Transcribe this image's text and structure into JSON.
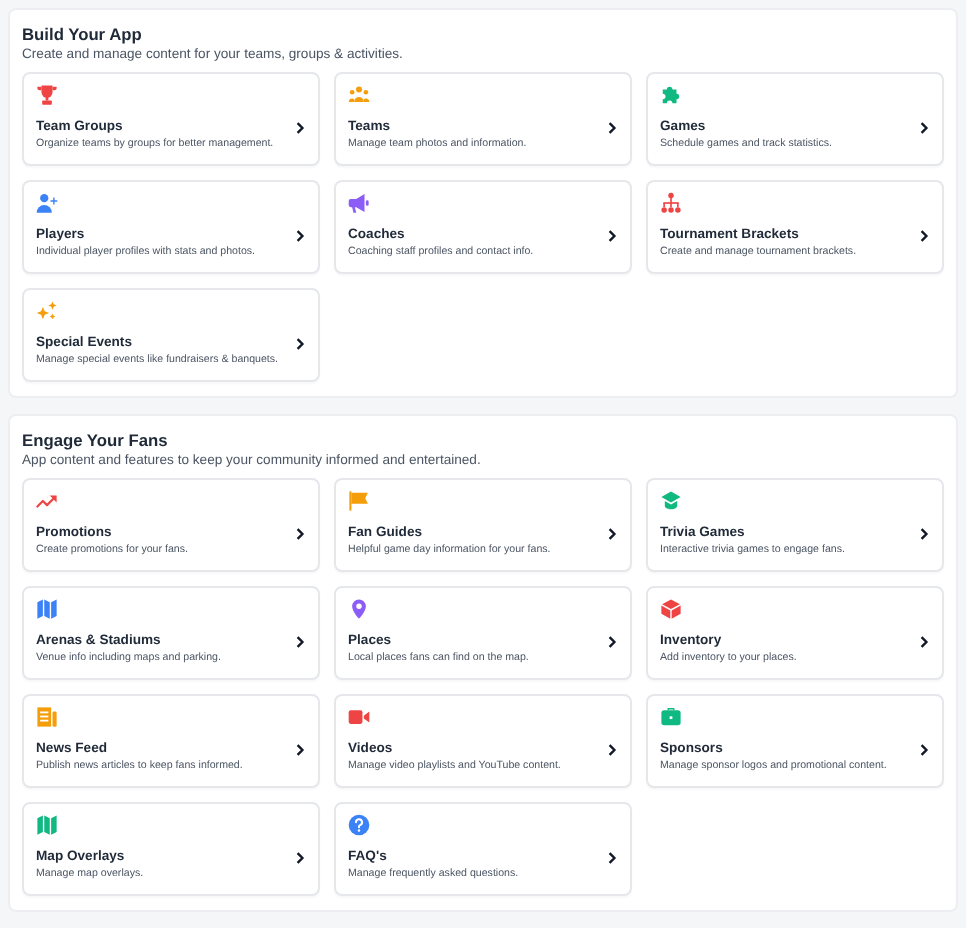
{
  "sections": [
    {
      "title": "Build Your App",
      "subtitle": "Create and manage content for your teams, groups & activities.",
      "items": [
        {
          "kind": "trophy",
          "color": "#ef4444",
          "title": "Team Groups",
          "description": "Organize teams by groups for better management."
        },
        {
          "kind": "people",
          "color": "#f59e0b",
          "title": "Teams",
          "description": "Manage team photos and information."
        },
        {
          "kind": "puzzle",
          "color": "#10b981",
          "title": "Games",
          "description": "Schedule games and track statistics."
        },
        {
          "kind": "userplus",
          "color": "#3b82f6",
          "title": "Players",
          "description": "Individual player profiles with stats and photos."
        },
        {
          "kind": "megaphone",
          "color": "#8b5cf6",
          "title": "Coaches",
          "description": "Coaching staff profiles and contact info."
        },
        {
          "kind": "sitemap",
          "color": "#ef4444",
          "title": "Tournament Brackets",
          "description": "Create and manage tournament brackets."
        },
        {
          "kind": "sparkles",
          "color": "#f59e0b",
          "title": "Special Events",
          "description": "Manage special events like fundraisers & banquets."
        }
      ]
    },
    {
      "title": "Engage Your Fans",
      "subtitle": "App content and features to keep your community informed and entertained.",
      "items": [
        {
          "kind": "trend",
          "color": "#ef4444",
          "title": "Promotions",
          "description": "Create promotions for your fans."
        },
        {
          "kind": "flag",
          "color": "#f59e0b",
          "title": "Fan Guides",
          "description": "Helpful game day information for your fans."
        },
        {
          "kind": "cap",
          "color": "#10b981",
          "title": "Trivia Games",
          "description": "Interactive trivia games to engage fans."
        },
        {
          "kind": "map",
          "color": "#3b82f6",
          "title": "Arenas & Stadiums",
          "description": "Venue info including maps and parking."
        },
        {
          "kind": "pin",
          "color": "#8b5cf6",
          "title": "Places",
          "description": "Local places fans can find on the map."
        },
        {
          "kind": "cube",
          "color": "#ef4444",
          "title": "Inventory",
          "description": "Add inventory to your places."
        },
        {
          "kind": "news",
          "color": "#f59e0b",
          "title": "News Feed",
          "description": "Publish news articles to keep fans informed."
        },
        {
          "kind": "video",
          "color": "#ef4444",
          "title": "Videos",
          "description": "Manage video playlists and YouTube content."
        },
        {
          "kind": "briefcase",
          "color": "#10b981",
          "title": "Sponsors",
          "description": "Manage sponsor logos and promotional content."
        },
        {
          "kind": "map",
          "color": "#10b981",
          "title": "Map Overlays",
          "description": "Manage map overlays."
        },
        {
          "kind": "question",
          "color": "#3b82f6",
          "title": "FAQ's",
          "description": "Manage frequently asked questions."
        }
      ]
    }
  ]
}
